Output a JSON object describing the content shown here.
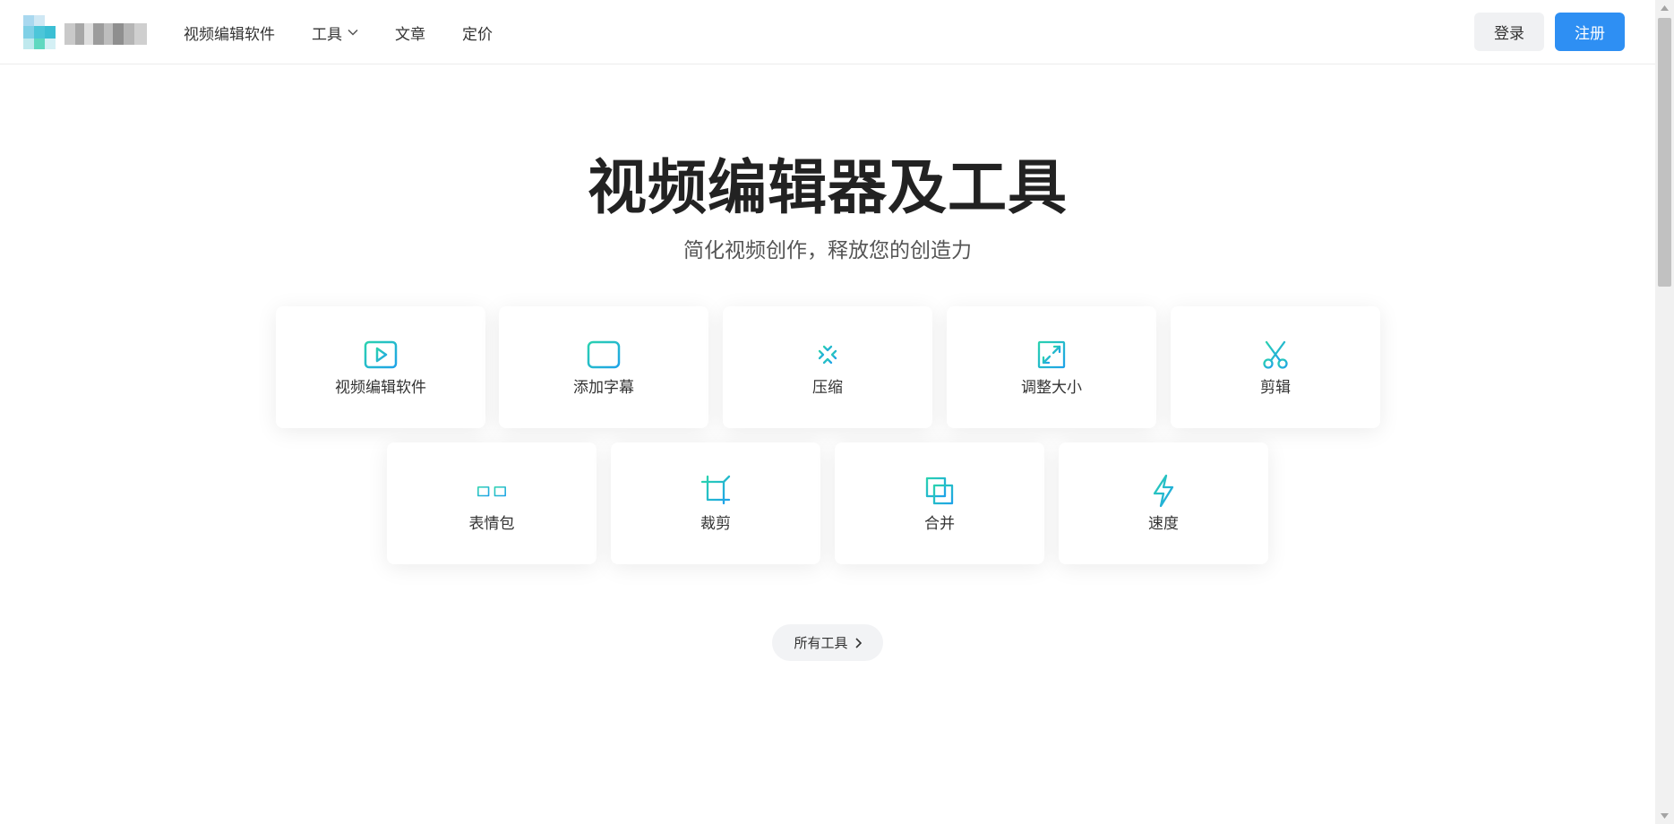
{
  "header": {
    "nav": [
      {
        "label": "视频编辑软件"
      },
      {
        "label": "工具",
        "has_dropdown": true
      },
      {
        "label": "文章"
      },
      {
        "label": "定价"
      }
    ],
    "login_label": "登录",
    "register_label": "注册"
  },
  "hero": {
    "title": "视频编辑器及工具",
    "subtitle": "简化视频创作，释放您的创造力"
  },
  "tools": [
    {
      "label": "视频编辑软件",
      "icon": "video-play-icon"
    },
    {
      "label": "添加字幕",
      "icon": "subtitle-icon"
    },
    {
      "label": "压缩",
      "icon": "compress-icon"
    },
    {
      "label": "调整大小",
      "icon": "resize-icon"
    },
    {
      "label": "剪辑",
      "icon": "scissors-icon"
    },
    {
      "label": "表情包",
      "icon": "glasses-icon"
    },
    {
      "label": "裁剪",
      "icon": "crop-icon"
    },
    {
      "label": "合并",
      "icon": "merge-icon"
    },
    {
      "label": "速度",
      "icon": "lightning-icon"
    }
  ],
  "all_tools_label": "所有工具",
  "colors": {
    "accent": "#2e8ff3",
    "icon_gradient_start": "#2ad1b0",
    "icon_gradient_end": "#1fa3e8"
  }
}
